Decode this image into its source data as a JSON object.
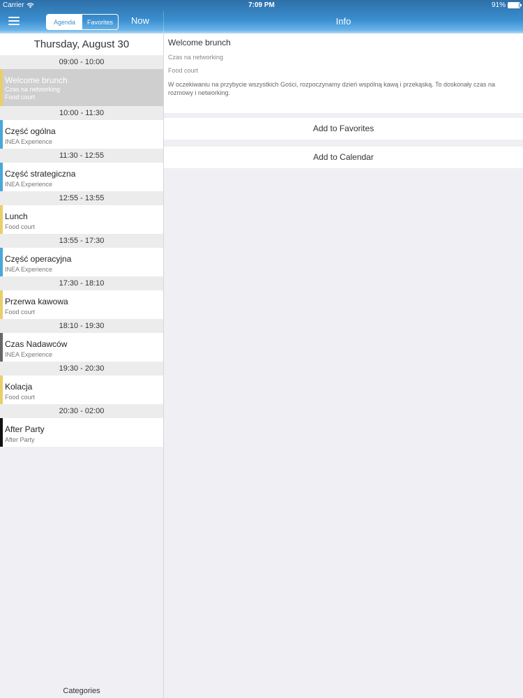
{
  "status_bar": {
    "carrier": "Carrier",
    "time": "7:09 PM",
    "battery": "91%",
    "battery_level": 0.91
  },
  "header": {
    "tabs": [
      {
        "label": "Agenda",
        "active": true
      },
      {
        "label": "Favorites",
        "active": false
      }
    ],
    "now_label": "Now",
    "info_title": "Info"
  },
  "agenda": {
    "date": "Thursday, August 30",
    "slots": [
      {
        "time": "09:00 - 10:00",
        "title": "Welcome brunch",
        "subtitle": "Czas na networking",
        "location": "Food court",
        "color": "#e8cf6a",
        "selected": true
      },
      {
        "time": "10:00 - 11:30",
        "title": "Część ogólna",
        "subtitle": "INEA Experience",
        "color": "#4aa8d8"
      },
      {
        "time": "11:30 - 12:55",
        "title": "Część strategiczna",
        "subtitle": "INEA Experience",
        "color": "#4aa8d8"
      },
      {
        "time": "12:55 - 13:55",
        "title": "Lunch",
        "subtitle": "Food court",
        "color": "#e8cf6a"
      },
      {
        "time": "13:55 - 17:30",
        "title": "Część operacyjna",
        "subtitle": "INEA Experience",
        "color": "#4aa8d8"
      },
      {
        "time": "17:30 - 18:10",
        "title": "Przerwa kawowa",
        "subtitle": "Food court",
        "color": "#e8cf6a"
      },
      {
        "time": "18:10 - 19:30",
        "title": "Czas Nadawców",
        "subtitle": "INEA Experience",
        "color": "#666666"
      },
      {
        "time": "19:30 - 20:30",
        "title": "Kolacja",
        "subtitle": "Food court",
        "color": "#e8cf6a"
      },
      {
        "time": "20:30 - 02:00",
        "title": "After Party",
        "subtitle": "After Party",
        "color": "#111111"
      }
    ],
    "categories_label": "Categories"
  },
  "info": {
    "title": "Welcome brunch",
    "subtitle": "Czas na networking",
    "location": "Food court",
    "description": "W oczekiwaniu na przybycie wszystkich Gości, rozpoczynamy dzień wspólną kawą i przekąską. To doskonały czas na rozmowy i networking.",
    "add_favorites": "Add to Favorites",
    "add_calendar": "Add to Calendar"
  }
}
